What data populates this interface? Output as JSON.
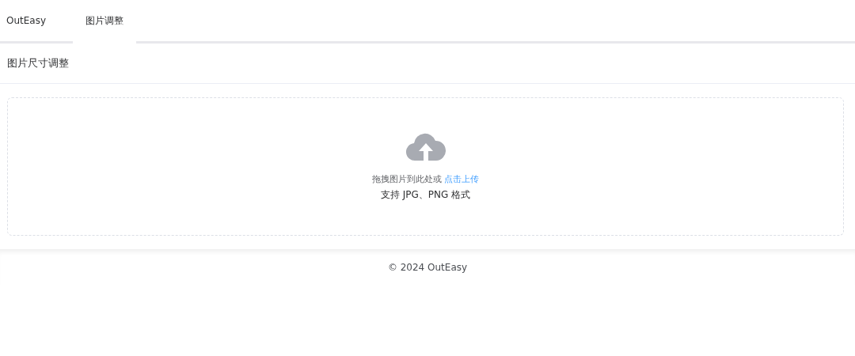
{
  "header": {
    "logo": "OutEasy",
    "menu": [
      {
        "label": "图片调整",
        "selected": true
      }
    ]
  },
  "card": {
    "title": "图片尺寸调整",
    "upload": {
      "prompt": "拖拽图片到此处或",
      "link": "点击上传",
      "hint": "支持 JPG、PNG 格式"
    }
  },
  "footer": {
    "text": "© 2024 OutEasy"
  }
}
